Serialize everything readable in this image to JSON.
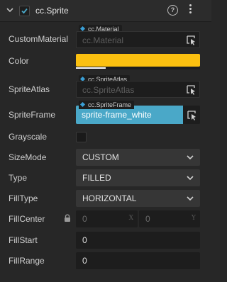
{
  "component": {
    "title": "cc.Sprite",
    "enabled": true,
    "icons": {
      "collapse": "chevron-down-icon",
      "help": "help-icon",
      "more": "more-vertical-icon"
    },
    "help_glyph": "?"
  },
  "props": {
    "custom_material": {
      "label": "CustomMaterial",
      "type_tag": "cc.Material",
      "value": "cc.Material"
    },
    "color": {
      "label": "Color",
      "hex": "#fbc010",
      "alpha_fraction": 0.24
    },
    "sprite_atlas": {
      "label": "SpriteAtlas",
      "type_tag": "cc.SpriteAtlas",
      "value": "cc.SpriteAtlas"
    },
    "sprite_frame": {
      "label": "SpriteFrame",
      "type_tag": "cc.SpriteFrame",
      "value": "sprite-frame_white"
    },
    "grayscale": {
      "label": "Grayscale",
      "checked": false
    },
    "size_mode": {
      "label": "SizeMode",
      "value": "CUSTOM"
    },
    "type": {
      "label": "Type",
      "value": "FILLED"
    },
    "fill_type": {
      "label": "FillType",
      "value": "HORIZONTAL"
    },
    "fill_center": {
      "label": "FillCenter",
      "x": "0",
      "y": "0",
      "x_axis": "X",
      "y_axis": "Y",
      "locked": true
    },
    "fill_start": {
      "label": "FillStart",
      "value": "0"
    },
    "fill_range": {
      "label": "FillRange",
      "value": "0"
    }
  },
  "colors": {
    "accent": "#4aa8c8",
    "tag_dot": "#3a9fd6",
    "panel_bg": "#272727",
    "field_bg": "#1d1d1d"
  }
}
